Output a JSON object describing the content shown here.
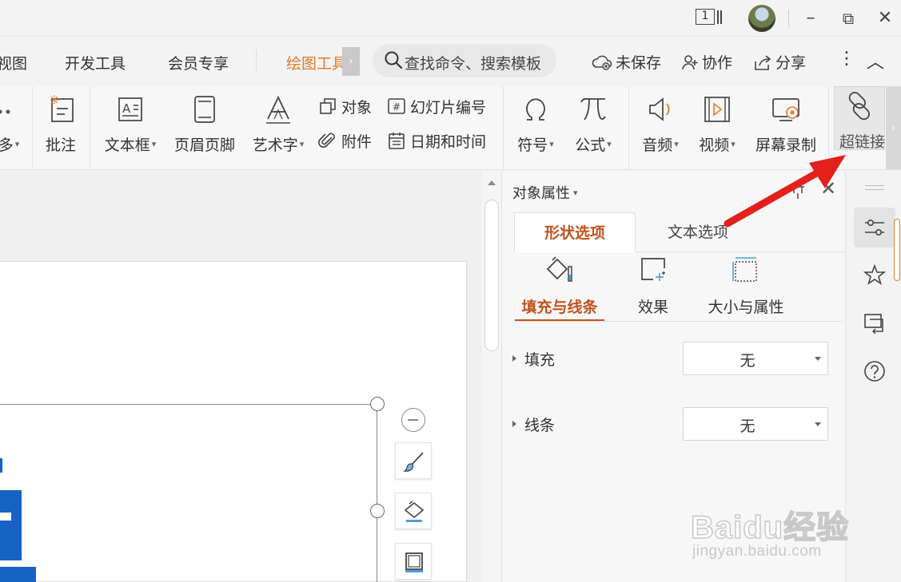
{
  "titlebar": {
    "page_count": "1",
    "controls": {
      "minimize": "–",
      "restore": "⧉",
      "close": "✕"
    }
  },
  "menu": {
    "items": [
      "视图",
      "开发工具",
      "会员专享",
      "绘图工具"
    ],
    "active_item": "绘图工具",
    "scroll_glyph": "›",
    "search_placeholder": "查找命令、搜索模板",
    "unsaved": "未保存",
    "collaborate": "协作",
    "share": "分享",
    "more": "⋮",
    "collapse": "︿"
  },
  "ribbon": {
    "more_partial": "多",
    "comment": "批注",
    "textbox": "文本框",
    "header_footer": "页眉页脚",
    "wordart": "艺术字",
    "object": "对象",
    "slide_number": "幻灯片编号",
    "attachment": "附件",
    "date_time": "日期和时间",
    "symbol": "符号",
    "formula": "公式",
    "audio": "音频",
    "video": "视频",
    "screen_record": "屏幕录制",
    "hyperlink": "超链接",
    "slide_number_icon_text": "#",
    "scroll_glyph": "›"
  },
  "panel": {
    "title": "对象属性",
    "tabs": [
      "形状选项",
      "文本选项"
    ],
    "active_tab": "形状选项",
    "subtabs": [
      "填充与线条",
      "效果",
      "大小与属性"
    ],
    "active_subtab": "填充与线条",
    "fill_label": "填充",
    "fill_value": "无",
    "line_label": "线条",
    "line_value": "无"
  },
  "watermark": {
    "logo": "Baidu经验",
    "url": "jingyan.baidu.com"
  },
  "colors": {
    "accent_orange": "#e07a2c",
    "panel_accent": "#c0541f",
    "slide_blue": "#1763c5",
    "arrow_red": "#e3201b"
  }
}
